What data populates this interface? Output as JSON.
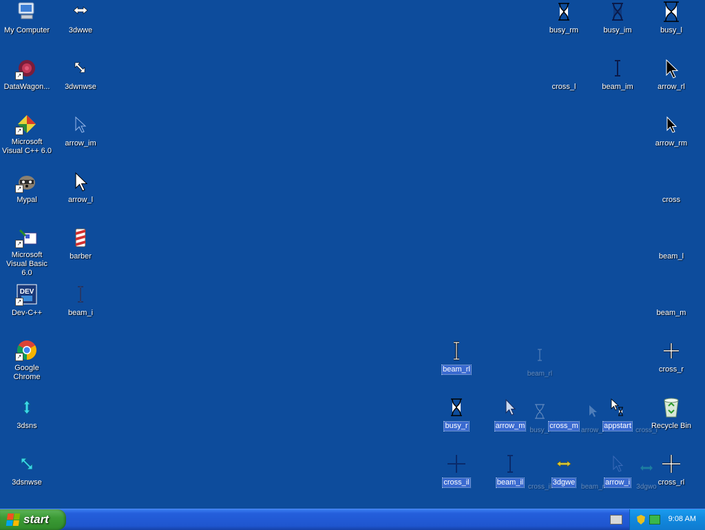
{
  "desktop": {
    "left_column": [
      {
        "label": "My Computer"
      },
      {
        "label": "DataWagon..."
      },
      {
        "label": "Microsoft Visual C++ 6.0"
      },
      {
        "label": "Mypal"
      },
      {
        "label": "Microsoft Visual Basic 6.0"
      },
      {
        "label": "Dev-C++"
      },
      {
        "label": "Google Chrome"
      },
      {
        "label": "3dsns"
      },
      {
        "label": "3dsnwse"
      }
    ],
    "second_column": [
      {
        "label": "3dwwe"
      },
      {
        "label": "3dwnwse"
      },
      {
        "label": "arrow_im"
      },
      {
        "label": "arrow_l"
      },
      {
        "label": "barber"
      },
      {
        "label": "beam_i"
      }
    ],
    "top_right": [
      {
        "label": "busy_rm"
      },
      {
        "label": "busy_im"
      },
      {
        "label": "busy_l"
      },
      {
        "label": "cross_l"
      },
      {
        "label": "beam_im"
      },
      {
        "label": "arrow_rl"
      },
      {
        "label": "arrow_rm"
      },
      {
        "label": "cross"
      },
      {
        "label": "beam_l"
      },
      {
        "label": "beam_m"
      },
      {
        "label": "cross_r"
      },
      {
        "label": "Recycle Bin"
      },
      {
        "label": "cross_rl"
      }
    ],
    "bottom_cluster": [
      {
        "label": "beam_rl"
      },
      {
        "label": "beam_rl"
      },
      {
        "label": "busy_r"
      },
      {
        "label": "arrow_m"
      },
      {
        "label": "busy_i"
      },
      {
        "label": "cross_m"
      },
      {
        "label": "arrow_r"
      },
      {
        "label": "appstart"
      },
      {
        "label": "cross_i"
      },
      {
        "label": "cross_il"
      },
      {
        "label": "beam_il"
      },
      {
        "label": "cross_il"
      },
      {
        "label": "3dgwe"
      },
      {
        "label": "beam_r"
      },
      {
        "label": "arrow_i"
      },
      {
        "label": "3dgwo"
      }
    ]
  },
  "taskbar": {
    "start_label": "start",
    "clock": "9:08 AM"
  },
  "colors": {
    "desktop_bg": "#0d4c9c",
    "taskbar_bg": "#245edb",
    "start_green": "#3c9b36",
    "tray_bg": "#128adf",
    "selection": "#3a6ad0"
  }
}
